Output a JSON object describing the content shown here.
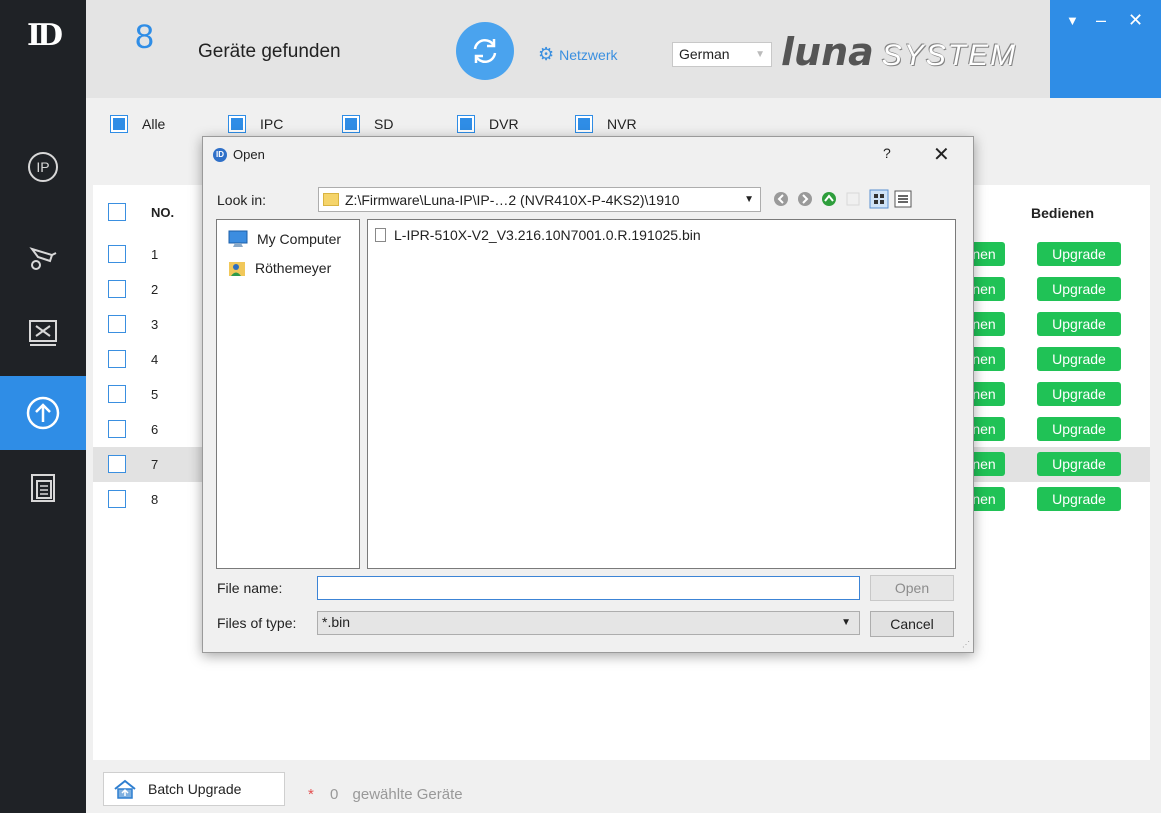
{
  "header": {
    "device_count": "8",
    "found_label": "Geräte gefunden",
    "network_label": "Netzwerk",
    "language": "German",
    "brand_luna": "luna",
    "brand_system": "SYSTEM",
    "colors": {
      "accent": "#2f8de6",
      "sidebar": "#1f2226",
      "upgrade_green": "#20c256"
    }
  },
  "sidebar": {
    "logo": "ID",
    "items": [
      {
        "icon": "ip-icon"
      },
      {
        "icon": "camera-settings-icon"
      },
      {
        "icon": "tools-icon"
      },
      {
        "icon": "upgrade-icon",
        "active": true
      },
      {
        "icon": "documents-icon"
      }
    ]
  },
  "filters": [
    {
      "label": "Alle",
      "checked": true
    },
    {
      "label": "IPC",
      "checked": true
    },
    {
      "label": "SD",
      "checked": true
    },
    {
      "label": "DVR",
      "checked": true
    },
    {
      "label": "NVR",
      "checked": true
    }
  ],
  "table": {
    "col_no": "NO.",
    "col_actions": "Bedienen",
    "partial_button": "nen",
    "upgrade_label": "Upgrade",
    "rows": [
      "1",
      "2",
      "3",
      "4",
      "5",
      "6",
      "7",
      "8"
    ],
    "selected_row": "7"
  },
  "bottom": {
    "batch_label": "Batch Upgrade",
    "star": "*",
    "selected_count": "0",
    "selected_label": "gewählte Geräte"
  },
  "dialog": {
    "title": "Open",
    "help": "?",
    "close": "✕",
    "look_in_label": "Look in:",
    "look_in_path": "Z:\\Firmware\\Luna-IP\\IP-…2 (NVR410X-P-4KS2)\\1910",
    "places": [
      "My Computer",
      "Röthemeyer"
    ],
    "files": [
      "L-IPR-510X-V2_V3.216.10N7001.0.R.191025.bin"
    ],
    "file_name_label": "File name:",
    "file_name_value": "",
    "files_of_type_label": "Files of type:",
    "files_of_type_value": "*.bin",
    "open_label": "Open",
    "cancel_label": "Cancel"
  }
}
